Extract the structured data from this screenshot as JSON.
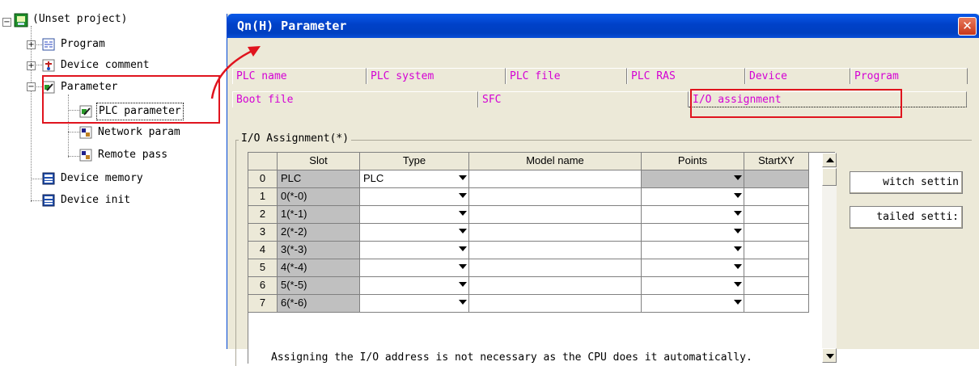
{
  "tree": {
    "root": "(Unset project)",
    "items": [
      "Program",
      "Device comment",
      "Parameter",
      "PLC parameter",
      "Network param",
      "Remote pass",
      "Device memory",
      "Device init"
    ],
    "expanders": [
      "−",
      "+",
      "+",
      "−"
    ]
  },
  "dialog": {
    "title": "Qn(H) Parameter",
    "close_glyph": "✕",
    "tabs_row1": [
      "PLC name",
      "PLC system",
      "PLC file",
      "PLC RAS",
      "Device",
      "Program"
    ],
    "tabs_row2": [
      "Boot file",
      "SFC",
      "I/O assignment"
    ],
    "group_label": "I/O Assignment(*)",
    "grid": {
      "headers": [
        "",
        "Slot",
        "Type",
        "Model name",
        "Points",
        "StartXY"
      ],
      "rows": [
        {
          "no": "0",
          "slot": "PLC",
          "type": "PLC"
        },
        {
          "no": "1",
          "slot": "0(*-0)",
          "type": ""
        },
        {
          "no": "2",
          "slot": "1(*-1)",
          "type": ""
        },
        {
          "no": "3",
          "slot": "2(*-2)",
          "type": ""
        },
        {
          "no": "4",
          "slot": "3(*-3)",
          "type": ""
        },
        {
          "no": "5",
          "slot": "4(*-4)",
          "type": ""
        },
        {
          "no": "6",
          "slot": "5(*-5)",
          "type": ""
        },
        {
          "no": "7",
          "slot": "6(*-6)",
          "type": ""
        }
      ]
    },
    "buttons": {
      "switch": "witch settin",
      "detailed": "tailed setti:"
    },
    "notice": "Assigning the I/O address is not necessary as the CPU does it automatically."
  },
  "colors": {
    "tab_text": "#d400d4",
    "highlight": "#e0141e",
    "titlebar": "#0041c8"
  },
  "icons": [
    "project-icon",
    "program-icon",
    "device-comment-icon",
    "parameter-icon",
    "plc-parameter-icon",
    "network-param-icon",
    "remote-pass-icon",
    "device-memory-icon",
    "device-init-icon"
  ]
}
